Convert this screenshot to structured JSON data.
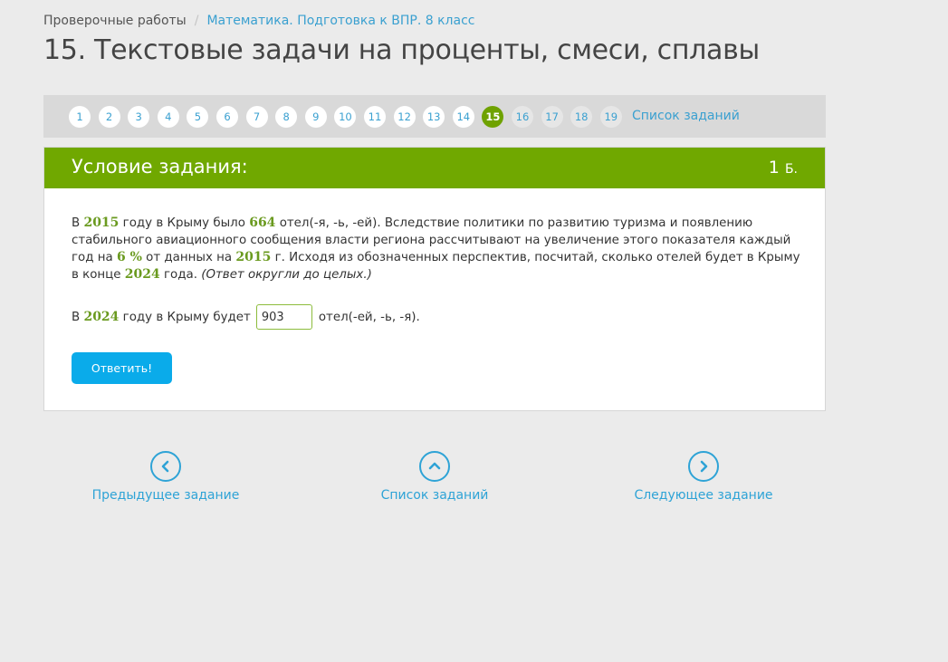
{
  "breadcrumb": {
    "root": "Проверочные работы",
    "separator": "/",
    "course": "Математика. Подготовка к ВПР. 8 класс"
  },
  "title": "15. Текстовые задачи на проценты, смеси, сплавы",
  "pager": {
    "numbers": [
      "1",
      "2",
      "3",
      "4",
      "5",
      "6",
      "7",
      "8",
      "9",
      "10",
      "11",
      "12",
      "13",
      "14",
      "15",
      "16",
      "17",
      "18",
      "19"
    ],
    "current": "15",
    "list_label": "Список заданий"
  },
  "task": {
    "header": "Условие задания:",
    "points_value": "1",
    "points_unit": "Б.",
    "problem": {
      "t1": "В ",
      "n1": "2015",
      "t2": " году в Крыму было ",
      "n2": "664",
      "t3": " отел(-я, -ь, -ей). Вследствие политики по развитию туризма и появлению стабильного авиационного сообщения власти региона рассчитывают на увеличение этого показателя каждый год на ",
      "n3": "6 %",
      "t4": " от данных на ",
      "n4": "2015",
      "t5": " г. Исходя из обозначенных перспектив, посчитай, сколько отелей будет в Крыму в конце ",
      "n5": "2024",
      "t6": " года. ",
      "hint": "(Ответ округли до целых.)"
    },
    "answer": {
      "prefix": "В ",
      "year": "2024",
      "middle": " году в Крыму будет",
      "value": "903",
      "suffix": "отел(-ей, -ь, -я)."
    },
    "submit_label": "Ответить!"
  },
  "navigation": {
    "prev_label": "Предыдущее задание",
    "list_label": "Список заданий",
    "next_label": "Следующее задание"
  },
  "colors": {
    "accent_green": "#70a800",
    "link_blue": "#2ea3d6",
    "button_blue": "#0aabea",
    "background": "#ebebeb"
  },
  "icons": {
    "prev": "chevron-left-icon",
    "list": "chevron-up-icon",
    "next": "chevron-right-icon"
  }
}
